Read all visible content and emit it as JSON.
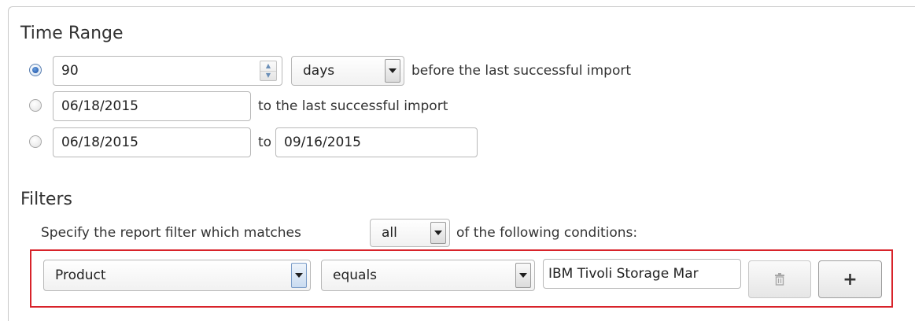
{
  "time_range": {
    "title": "Time Range",
    "option1": {
      "selected": true,
      "value": "90",
      "unit": "days",
      "suffix": "before the last successful import"
    },
    "option2": {
      "selected": false,
      "from_date": "06/18/2015",
      "suffix": "to the last successful import"
    },
    "option3": {
      "selected": false,
      "from_date": "06/18/2015",
      "connector": "to",
      "to_date": "09/16/2015"
    }
  },
  "filters": {
    "title": "Filters",
    "match_prefix": "Specify the report filter which matches",
    "match_value": "all",
    "match_suffix": "of the following conditions:",
    "condition": {
      "field": "Product",
      "operator": "equals",
      "value": "IBM Tivoli Storage Mar"
    },
    "delete_icon": "trash-icon",
    "add_label": "+"
  },
  "colors": {
    "highlight_border": "#d8232a",
    "radio_selected": "#2f64b3"
  }
}
